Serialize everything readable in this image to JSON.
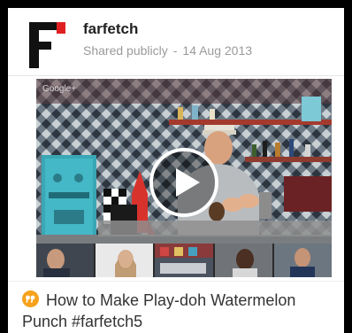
{
  "post": {
    "author": "farfetch",
    "visibility": "Shared publicly",
    "separator": "-",
    "date": "14 Aug 2013",
    "logo_icon": "farfetch-f-logo-icon"
  },
  "media": {
    "watermark": "Google+",
    "play_icon": "play-icon",
    "participants": 5
  },
  "caption": {
    "icon": "quote-icon",
    "text": "How to Make Play-doh Watermelon Punch #farfetch5"
  },
  "colors": {
    "logo_red": "#e02020",
    "logo_black": "#111111",
    "quote_orange": "#f6a21c",
    "meta_gray": "#9a9a9a"
  }
}
